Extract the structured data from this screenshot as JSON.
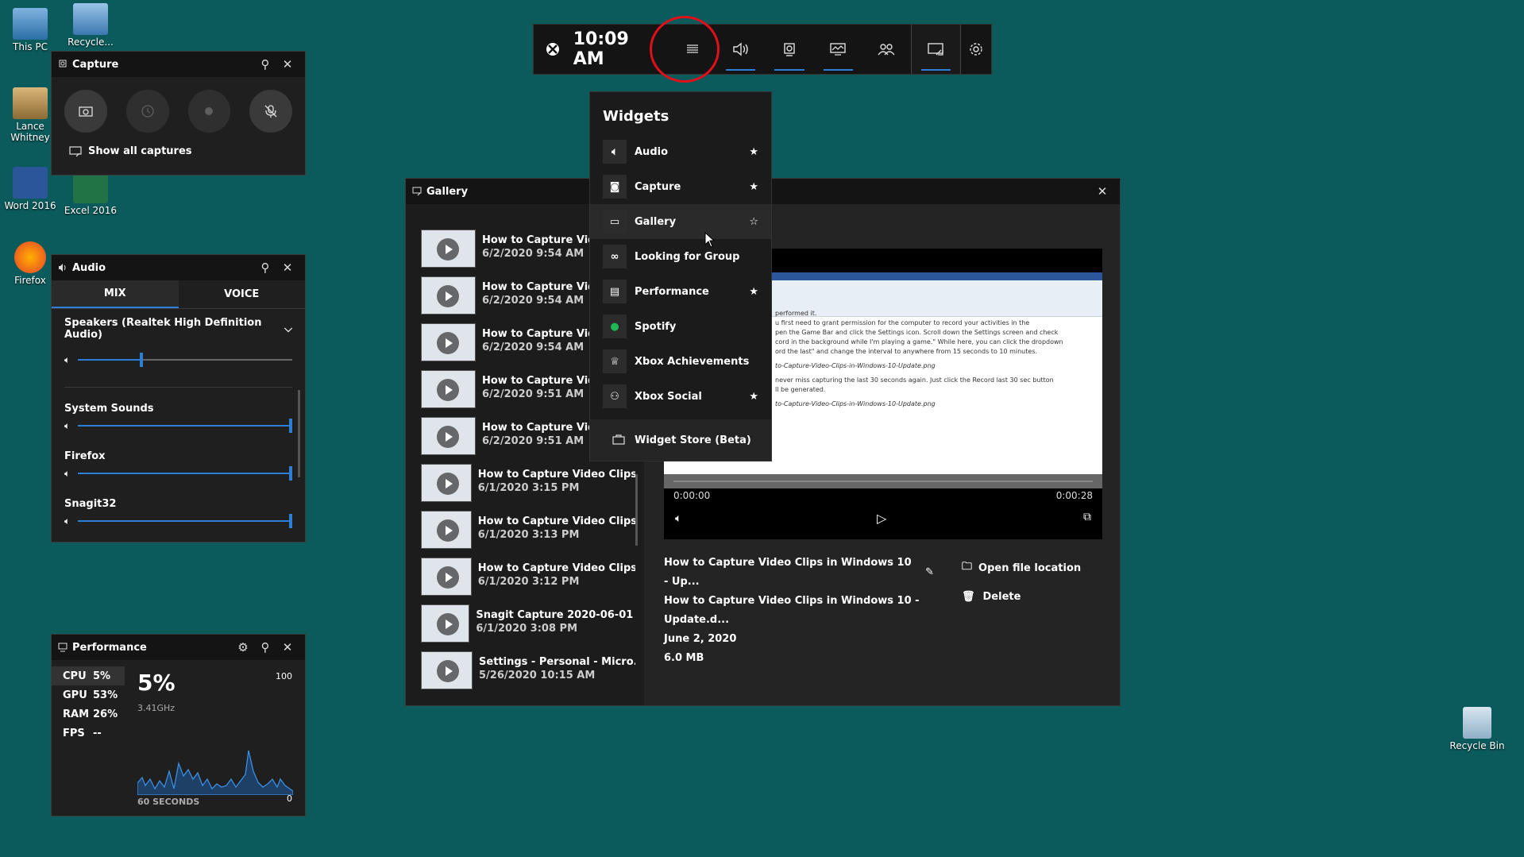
{
  "desktop": {
    "icons": [
      {
        "label": "This PC"
      },
      {
        "label": "Recycle..."
      },
      {
        "label": "Lance Whitney"
      },
      {
        "label": "Word 2016"
      },
      {
        "label": "Excel 2016"
      },
      {
        "label": "Firefox"
      },
      {
        "label": "Recycle Bin"
      }
    ]
  },
  "topbar": {
    "time": "10:09 AM"
  },
  "widgets_menu": {
    "title": "Widgets",
    "items": [
      {
        "label": "Audio",
        "star": "★"
      },
      {
        "label": "Capture",
        "star": "★"
      },
      {
        "label": "Gallery",
        "star": "☆"
      },
      {
        "label": "Looking for Group",
        "star": ""
      },
      {
        "label": "Performance",
        "star": "★"
      },
      {
        "label": "Spotify",
        "star": ""
      },
      {
        "label": "Xbox Achievements",
        "star": ""
      },
      {
        "label": "Xbox Social",
        "star": "★"
      }
    ],
    "store": "Widget Store (Beta)"
  },
  "capture": {
    "title": "Capture",
    "show_all": "Show all captures"
  },
  "audio": {
    "title": "Audio",
    "tabs": [
      "MIX",
      "VOICE"
    ],
    "device": "Speakers (Realtek High Definition Audio)",
    "apps": [
      {
        "name": "System Sounds"
      },
      {
        "name": "Firefox"
      },
      {
        "name": "Snagit32"
      }
    ]
  },
  "performance": {
    "title": "Performance",
    "stats": [
      {
        "label": "CPU",
        "value": "5%"
      },
      {
        "label": "GPU",
        "value": "53%"
      },
      {
        "label": "RAM",
        "value": "26%"
      },
      {
        "label": "FPS",
        "value": "--"
      }
    ],
    "big_value": "5%",
    "freq": "3.41GHz",
    "max": "100",
    "min": "0",
    "window": "60 SECONDS"
  },
  "gallery": {
    "title": "Gallery",
    "items": [
      {
        "title": "How to Capture Video",
        "date": "6/2/2020 9:54 AM"
      },
      {
        "title": "How to Capture Video",
        "date": "6/2/2020 9:54 AM"
      },
      {
        "title": "How to Capture Video",
        "date": "6/2/2020 9:54 AM"
      },
      {
        "title": "How to Capture Video",
        "date": "6/2/2020 9:51 AM"
      },
      {
        "title": "How to Capture Video",
        "date": "6/2/2020 9:51 AM"
      },
      {
        "title": "How to Capture Video Clips...",
        "date": "6/1/2020 3:15 PM"
      },
      {
        "title": "How to Capture Video Clips...",
        "date": "6/1/2020 3:13 PM"
      },
      {
        "title": "How to Capture Video Clips...",
        "date": "6/1/2020 3:12 PM"
      },
      {
        "title": "Snagit Capture 2020-06-01 1...",
        "date": "6/1/2020 3:08 PM"
      },
      {
        "title": "Settings - Personal - Micro...",
        "date": "5/26/2020 10:15 AM"
      }
    ],
    "player": {
      "time_start": "0:00:00",
      "time_end": "0:00:28"
    },
    "info": {
      "name": "How to Capture Video Clips in Windows 10 - Up...",
      "file": "How to Capture Video Clips in Windows 10 - Update.d...",
      "date": "June 2, 2020",
      "size": "6.0 MB"
    },
    "actions": {
      "open": "Open file location",
      "delete": "Delete"
    },
    "doc_lines": [
      "performed it.",
      "u first need to grant permission for the computer to record your activities in the",
      "pen the Game Bar and click the Settings icon. Scroll down the Settings screen and check",
      "cord in the background while I'm playing a game.\" While here, you can click the dropdown",
      "ord the last\" and change the interval to anywhere from 15 seconds to 10 minutes.",
      "to-Capture-Video-Clips-in-Windows-10-Update.png",
      "never miss capturing the last 30 seconds again. Just click the Record last 30 sec button",
      "ll be generated.",
      "to-Capture-Video-Clips-in-Windows-10-Update.png"
    ]
  }
}
